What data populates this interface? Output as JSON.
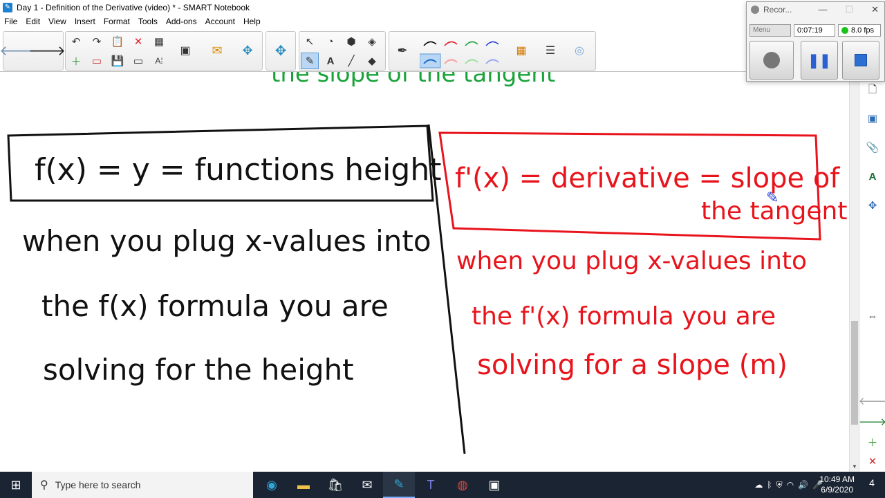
{
  "window": {
    "title": "Day 1 - Definition of the Derivative (video) * - SMART Notebook",
    "app_icon": "smart-notebook-icon"
  },
  "menubar": {
    "items": [
      "File",
      "Edit",
      "View",
      "Insert",
      "Format",
      "Tools",
      "Add-ons",
      "Account",
      "Help"
    ]
  },
  "toolbar": {
    "text_tool_label": "A",
    "pen_colors": [
      "#000000",
      "#e8141c",
      "#19a33a",
      "#2a3fd1"
    ]
  },
  "canvas": {
    "top_fragment": "the slope of the tangent",
    "left_box": "f(x) = y = functions height",
    "left_lines": [
      "when you plug x-values into",
      "the f(x) formula you are",
      "solving for the height"
    ],
    "right_box_line1": "f'(x) = derivative = slope of",
    "right_box_line2": "the tangent",
    "right_lines": [
      "when you plug x-values into",
      "the f'(x) formula you are",
      "solving for a slope (m)"
    ],
    "colors": {
      "black_ink": "#111111",
      "red_ink": "#e8141c",
      "green_ink": "#19a33a"
    }
  },
  "recorder": {
    "title": "Recor...",
    "menu_label": "Menu",
    "elapsed": "0:07:19",
    "fps": "8.0 fps"
  },
  "taskbar": {
    "search_placeholder": "Type here to search",
    "time": "10:49 AM",
    "date": "6/9/2020",
    "notification_count": "4"
  }
}
